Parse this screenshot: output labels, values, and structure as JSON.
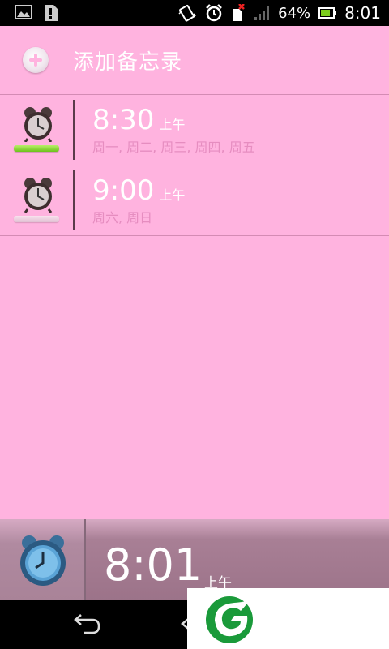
{
  "status_bar": {
    "battery": "64%",
    "time": "8:01",
    "icons": [
      "gallery-icon",
      "sim-icon",
      "vibrate-icon",
      "alarm-icon",
      "no-sim-icon",
      "signal-icon",
      "battery-icon"
    ]
  },
  "add_memo": {
    "label": "添加备忘录",
    "icon": "plus-circle-icon"
  },
  "alarms": [
    {
      "time": "8:30",
      "ampm": "上午",
      "days": "周一, 周二, 周三, 周四, 周五",
      "enabled": true
    },
    {
      "time": "9:00",
      "ampm": "上午",
      "days": "周六, 周日",
      "enabled": false
    }
  ],
  "current_clock": {
    "time": "8:01",
    "ampm": "上午"
  },
  "nav": {
    "back_icon": "back-icon",
    "home_icon": "home-icon"
  },
  "overlay": {
    "logo_icon": "leaf-logo-icon"
  },
  "colors": {
    "background": "#ffb3df",
    "toggle_on": "#7fce27",
    "days_text": "#e68dc0"
  }
}
